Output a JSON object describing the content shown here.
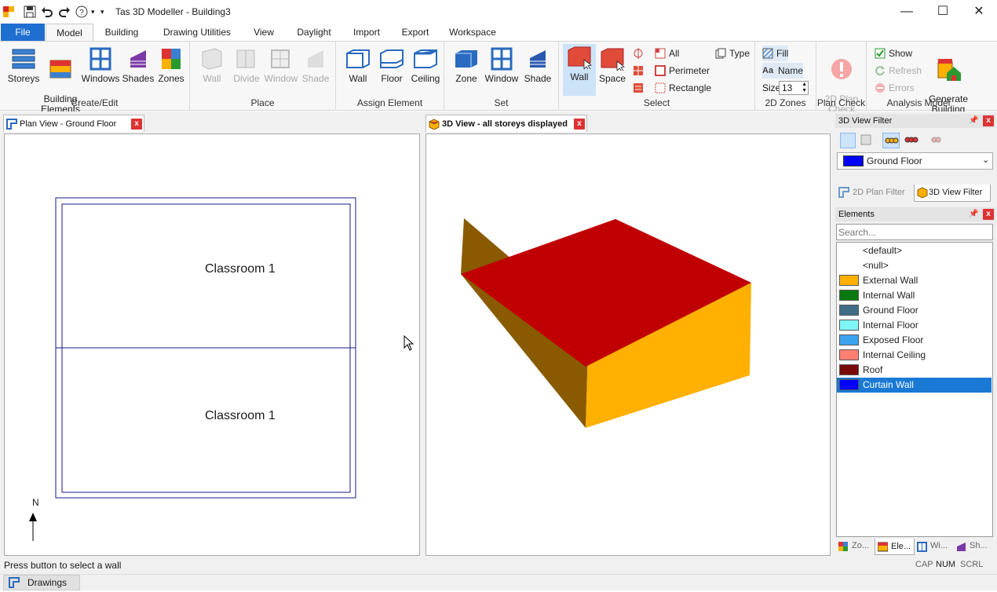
{
  "titlebar": {
    "title": "Tas 3D Modeller - Building3"
  },
  "tabs": [
    "File",
    "Model",
    "Building",
    "Drawing Utilities",
    "View",
    "Daylight",
    "Import",
    "Export",
    "Workspace"
  ],
  "ribbon": {
    "create_edit": {
      "label": "Create/Edit",
      "storeys": "Storeys",
      "building_elements": "Building\nElements",
      "windows": "Windows",
      "shades": "Shades",
      "zones": "Zones"
    },
    "place": {
      "label": "Place",
      "wall": "Wall",
      "divide": "Divide",
      "window": "Window",
      "shade": "Shade"
    },
    "assign": {
      "label": "Assign Element",
      "wall": "Wall",
      "floor": "Floor",
      "ceiling": "Ceiling"
    },
    "set": {
      "label": "Set",
      "zone": "Zone",
      "window": "Window",
      "shade": "Shade"
    },
    "select": {
      "label": "Select",
      "wall": "Wall",
      "space": "Space",
      "all": "All",
      "perimeter": "Perimeter",
      "rectangle": "Rectangle",
      "type": "Type"
    },
    "zones2d": {
      "label": "2D Zones",
      "fill": "Fill",
      "name": "Name",
      "size_label": "Size",
      "size_value": "13"
    },
    "plan_check": {
      "label": "Plan Check",
      "btn": "2D Plan\nCheck"
    },
    "analysis": {
      "label": "Analysis Model",
      "show": "Show",
      "refresh": "Refresh",
      "errors": "Errors",
      "generate": "Generate\nBuilding"
    }
  },
  "plan_view": {
    "tab": "Plan View - Ground Floor",
    "room_top": "Classroom 1",
    "room_bottom": "Classroom 1",
    "north": "N"
  },
  "view3d": {
    "tab": "3D View - all storeys displayed"
  },
  "filter_panel": {
    "title": "3D View Filter",
    "storey": "Ground Floor",
    "tab_2d": "2D Plan Filter",
    "tab_3d": "3D View Filter"
  },
  "elements_panel": {
    "title": "Elements",
    "search_placeholder": "Search...",
    "items": [
      {
        "label": "<default>",
        "color": ""
      },
      {
        "label": "<null>",
        "color": ""
      },
      {
        "label": "External Wall",
        "color": "#ffb000"
      },
      {
        "label": "Internal Wall",
        "color": "#0a7a10"
      },
      {
        "label": "Ground Floor",
        "color": "#3f6d88"
      },
      {
        "label": "Internal Floor",
        "color": "#7ff5f5"
      },
      {
        "label": "Exposed Floor",
        "color": "#3ba2f0"
      },
      {
        "label": "Internal Ceiling",
        "color": "#ff7f73"
      },
      {
        "label": "Roof",
        "color": "#7a0a0a"
      },
      {
        "label": "Curtain Wall",
        "color": "#0000ff"
      }
    ],
    "bottom_tabs": [
      "Zo...",
      "Ele...",
      "Wi...",
      "Sh..."
    ]
  },
  "status": {
    "message": "Press button to select a wall",
    "cap": "CAP",
    "num": "NUM",
    "scrl": "SCRL"
  },
  "bottombar": {
    "drawings": "Drawings"
  },
  "colors": {
    "roof": "#c00000",
    "wall_light": "#ffb000",
    "wall_dark": "#8a5a00",
    "accent": "#1f6fd1"
  }
}
